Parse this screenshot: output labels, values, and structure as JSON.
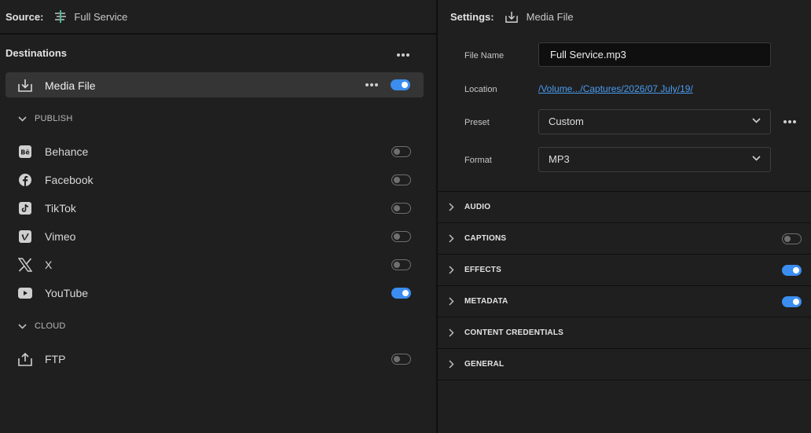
{
  "source": {
    "label": "Source:",
    "name": "Full Service"
  },
  "destinations": {
    "title": "Destinations",
    "media_file": {
      "label": "Media File",
      "enabled": true
    },
    "groups": [
      {
        "label": "PUBLISH"
      },
      {
        "label": "CLOUD"
      }
    ],
    "publish": [
      {
        "label": "Behance",
        "icon": "behance-icon",
        "enabled": false
      },
      {
        "label": "Facebook",
        "icon": "facebook-icon",
        "enabled": false
      },
      {
        "label": "TikTok",
        "icon": "tiktok-icon",
        "enabled": false
      },
      {
        "label": "Vimeo",
        "icon": "vimeo-icon",
        "enabled": false
      },
      {
        "label": "X",
        "icon": "x-icon",
        "enabled": false
      },
      {
        "label": "YouTube",
        "icon": "youtube-icon",
        "enabled": true
      }
    ],
    "cloud": [
      {
        "label": "FTP",
        "icon": "upload-icon",
        "enabled": false
      }
    ]
  },
  "settings": {
    "label": "Settings:",
    "name": "Media File",
    "fields": {
      "file_name_label": "File Name",
      "file_name_value": "Full Service.mp3",
      "location_label": "Location",
      "location_value": "/Volume.../Captures/2026/07 July/19/",
      "preset_label": "Preset",
      "preset_value": "Custom",
      "format_label": "Format",
      "format_value": "MP3"
    },
    "sections": [
      {
        "label": "AUDIO",
        "toggle": null
      },
      {
        "label": "CAPTIONS",
        "toggle": false
      },
      {
        "label": "EFFECTS",
        "toggle": true
      },
      {
        "label": "METADATA",
        "toggle": true
      },
      {
        "label": "CONTENT CREDENTIALS",
        "toggle": null
      },
      {
        "label": "GENERAL",
        "toggle": null
      }
    ]
  },
  "colors": {
    "accent": "#3b8df0",
    "background": "#1f1f1f",
    "link": "#4a9cf0"
  }
}
